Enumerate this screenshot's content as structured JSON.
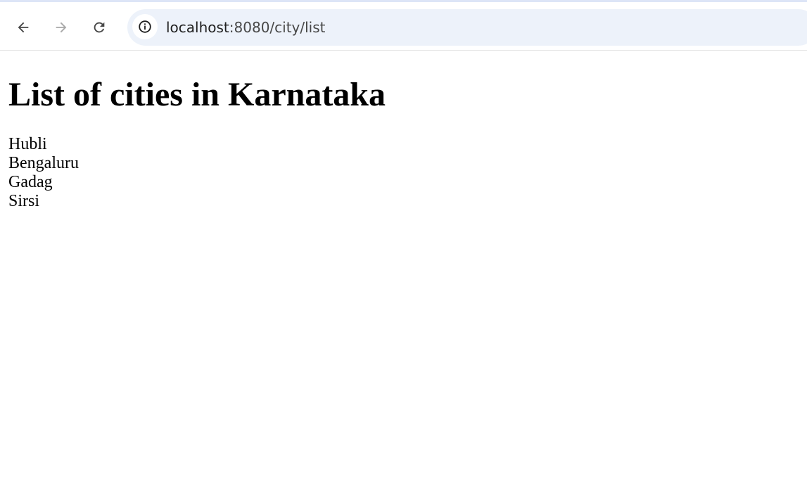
{
  "browser": {
    "url_host": "localhost",
    "url_path": ":8080/city/list"
  },
  "page": {
    "heading": "List of cities in Karnataka",
    "cities": [
      "Hubli",
      "Bengaluru",
      "Gadag",
      "Sirsi"
    ]
  }
}
